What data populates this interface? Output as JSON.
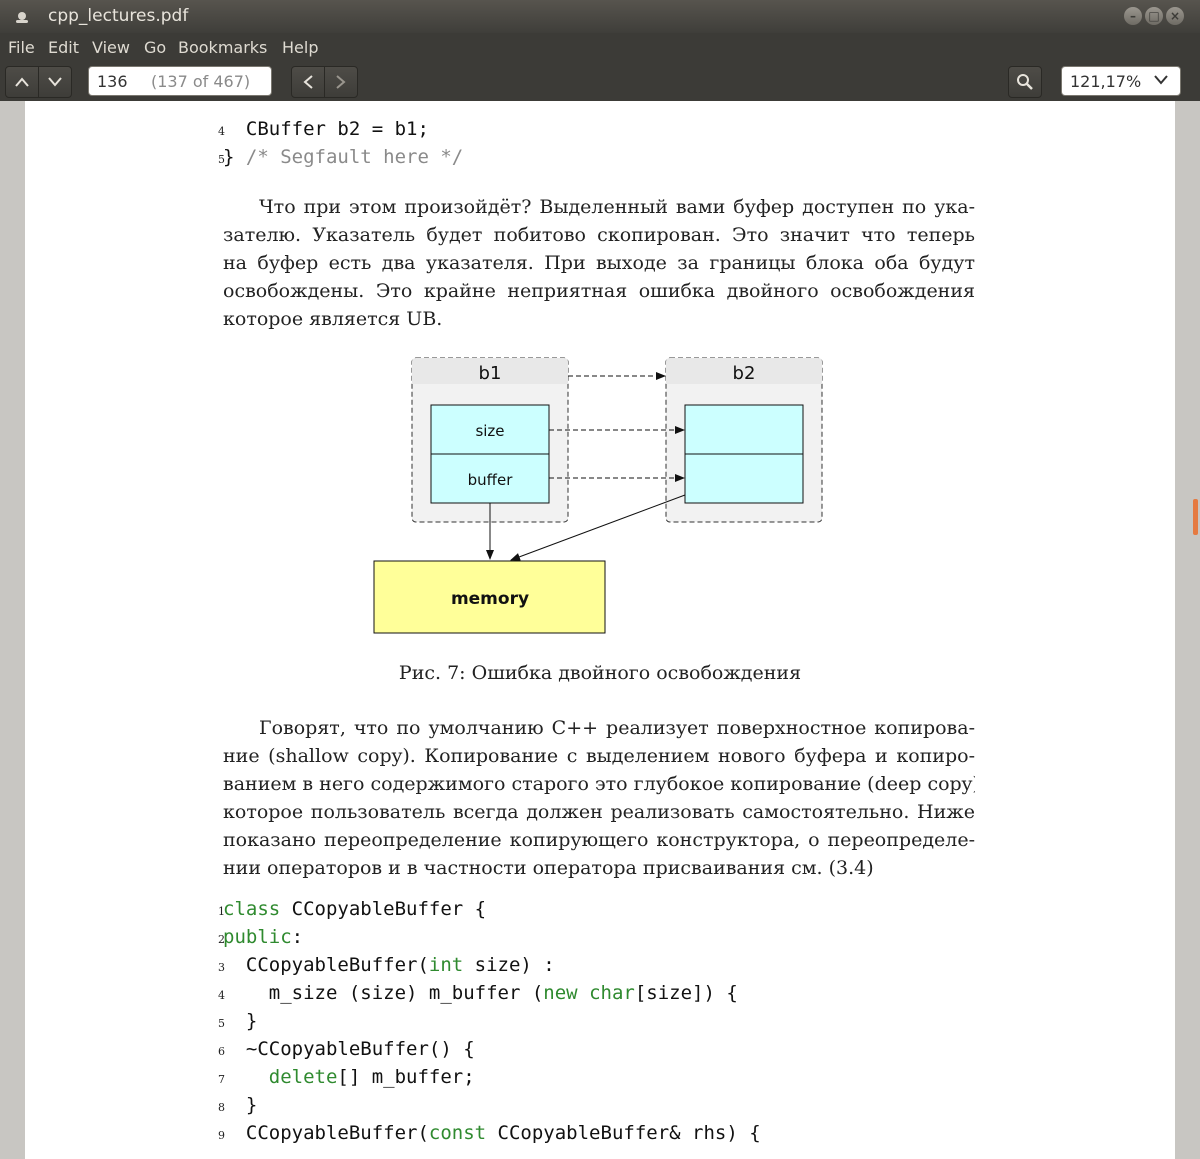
{
  "window": {
    "title": "cpp_lectures.pdf"
  },
  "menu": [
    "File",
    "Edit",
    "View",
    "Go",
    "Bookmarks",
    "Help"
  ],
  "toolbar": {
    "page_number": "136",
    "page_count": "(137 of 467)",
    "zoom": "121,17%"
  },
  "code_top": [
    {
      "num": "4",
      "text": "  CBuffer b2 = b1;"
    },
    {
      "num": "5",
      "text": "} ",
      "comment": "/* Segfault here */"
    }
  ],
  "paragraph1": [
    "Что при этом произойдёт? Выделенный вами буфер доступен по ука-",
    "зателю. Указатель будет побитово скопирован. Это значит что теперь",
    "на буфер есть два указателя. При выходе за границы блока оба будут",
    "освобождены. Это крайне неприятная ошибка двойного освобождения",
    "которое является UB."
  ],
  "diagram": {
    "b1_label": "b1",
    "b2_label": "b2",
    "size_label": "size",
    "buffer_label": "buffer",
    "memory_label": "memory",
    "colors": {
      "header": "#e8e8e8",
      "box": "#f2f2f2",
      "cell": "#ccffff",
      "memory": "#ffff99"
    }
  },
  "caption": "Рис. 7: Ошибка двойного освобождения",
  "paragraph2": [
    "Говорят, что по умолчанию C++ реализует поверхностное копирова-",
    "ние (shallow copy). Копирование с выделением нового буфера и копиро-",
    "ванием в него содержимого старого это глубокое копирование (deep copy)",
    "которое пользователь всегда должен реализовать самостоятельно. Ниже",
    "показано переопределение копирующего конструктора, о переопределе-",
    "нии операторов и в частности оператора присваивания см. (3.4)"
  ],
  "code_bottom": {
    "l1": {
      "num": "1",
      "kw": "class",
      "rest": " CCopyableBuffer {"
    },
    "l2": {
      "num": "2",
      "kw": "public",
      "rest": ":"
    },
    "l3": {
      "num": "3",
      "a": "  CCopyableBuffer(",
      "kw": "int",
      "b": " size) :"
    },
    "l4": {
      "num": "4",
      "a": "    m_size (size) m_buffer (",
      "kw1": "new",
      "sp": " ",
      "kw2": "char",
      "b": "[size]) {"
    },
    "l5": {
      "num": "5",
      "text": "  }"
    },
    "l6": {
      "num": "6",
      "text": "  ~CCopyableBuffer() {"
    },
    "l7": {
      "num": "7",
      "a": "    ",
      "kw": "delete",
      "b": "[] m_buffer;"
    },
    "l8": {
      "num": "8",
      "text": "  }"
    },
    "l9": {
      "num": "9",
      "a": "  CCopyableBuffer(",
      "kw": "const",
      "b": " CCopyableBuffer& rhs) {"
    }
  }
}
